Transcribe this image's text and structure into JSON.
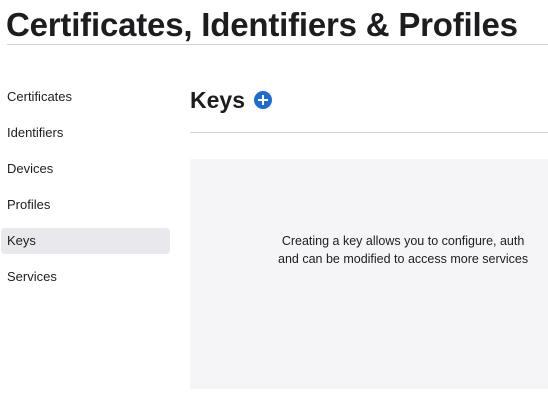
{
  "header": {
    "title": "Certificates, Identifiers & Profiles"
  },
  "sidebar": {
    "items": [
      {
        "label": "Certificates"
      },
      {
        "label": "Identifiers"
      },
      {
        "label": "Devices"
      },
      {
        "label": "Profiles"
      },
      {
        "label": "Keys",
        "active": true
      },
      {
        "label": "Services"
      }
    ]
  },
  "main": {
    "title": "Keys",
    "add_icon": "plus-circle-icon",
    "empty_state": {
      "line1": "Creating a key allows you to configure, auth",
      "line2": "and can be modified to access more services"
    }
  },
  "colors": {
    "accent": "#1f6bd4",
    "active_bg": "#e8e8ed",
    "panel_bg": "#f5f5f7"
  }
}
